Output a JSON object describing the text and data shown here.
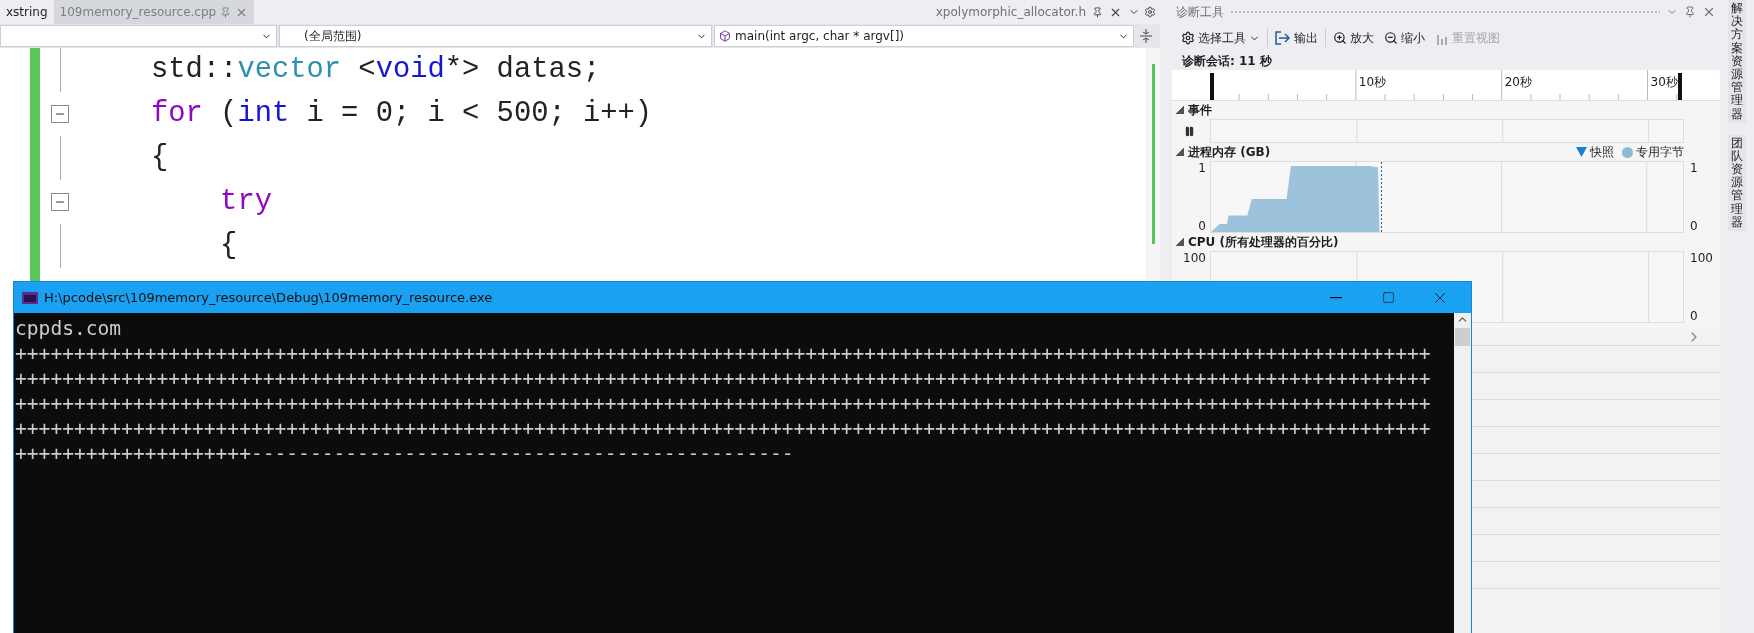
{
  "editor_tabs": [
    {
      "label": "xstring",
      "selected": false,
      "pinned": false
    },
    {
      "label": "109memory_resource.cpp",
      "selected": true,
      "pinned": true
    }
  ],
  "editor_tabs_right": {
    "label": "xpolymorphic_allocator.h",
    "pinned": true
  },
  "navigation_bar": {
    "scope": "(全局范围)",
    "member": "main(int argc, char * argv[])"
  },
  "code_lines": [
    {
      "foldable": false,
      "tokens": [
        {
          "kind": "plain",
          "text": "std::"
        },
        {
          "kind": "type",
          "text": "vector"
        },
        {
          "kind": "plain",
          "text": " <"
        },
        {
          "kind": "keyword",
          "text": "void"
        },
        {
          "kind": "plain",
          "text": "*> datas;"
        }
      ]
    },
    {
      "foldable": true,
      "tokens": [
        {
          "kind": "control",
          "text": "for"
        },
        {
          "kind": "plain",
          "text": " ("
        },
        {
          "kind": "keyword",
          "text": "int"
        },
        {
          "kind": "plain",
          "text": " i = 0; i < 500; i++)"
        }
      ]
    },
    {
      "foldable": false,
      "tokens": [
        {
          "kind": "plain",
          "text": "{"
        }
      ]
    },
    {
      "foldable": true,
      "tokens": [
        {
          "kind": "control",
          "text": "    try"
        }
      ]
    },
    {
      "foldable": false,
      "tokens": [
        {
          "kind": "plain",
          "text": "    {"
        }
      ]
    }
  ],
  "diagnostics": {
    "title": "诊断工具",
    "toolbar": [
      {
        "label": "选择工具",
        "kind": "tools",
        "disabled": false
      },
      {
        "label": "输出",
        "kind": "output",
        "disabled": false
      },
      {
        "label": "放大",
        "kind": "zoom_in",
        "disabled": false
      },
      {
        "label": "缩小",
        "kind": "zoom_out",
        "disabled": false
      },
      {
        "label": "重置视图",
        "kind": "reset",
        "disabled": true
      }
    ],
    "session": "诊断会话: 11 秒",
    "ruler_ticks": [
      "10秒",
      "20秒",
      "30秒"
    ],
    "events": {
      "title": "事件",
      "expanded": true
    },
    "memory": {
      "title": "进程内存 (GB)",
      "expanded": true,
      "legend": [
        {
          "label": "快照",
          "kind": "triangle",
          "color": "#1c7fd6"
        },
        {
          "label": "专用字节",
          "kind": "circle",
          "color": "#8fb9d6"
        }
      ],
      "left_ticks": [
        "1",
        "0"
      ],
      "right_ticks": [
        "1",
        "0"
      ]
    },
    "cpu": {
      "title": "CPU (所有处理器的百分比)",
      "expanded": true,
      "left_ticks": [
        "100"
      ],
      "right_ticks": [
        "100",
        "0"
      ]
    }
  },
  "side_tabs": [
    "解决方案资源管理器",
    "团队资源管理器"
  ],
  "console": {
    "title": "H:\\pcode\\src\\109memory_resource\\Debug\\109memory_resource.exe",
    "lines": [
      "cppds.com",
      "++++++++++++++++++++++++++++++++++++++++++++++++++++++++++++++++++++++++++++++++++++++++++++++++++++++++++++++++++++++++",
      "++++++++++++++++++++++++++++++++++++++++++++++++++++++++++++++++++++++++++++++++++++++++++++++++++++++++++++++++++++++++",
      "++++++++++++++++++++++++++++++++++++++++++++++++++++++++++++++++++++++++++++++++++++++++++++++++++++++++++++++++++++++++",
      "++++++++++++++++++++++++++++++++++++++++++++++++++++++++++++++++++++++++++++++++++++++++++++++++++++++++++++++++++++++++",
      "++++++++++++++++++++----------------------------------------------"
    ]
  }
}
